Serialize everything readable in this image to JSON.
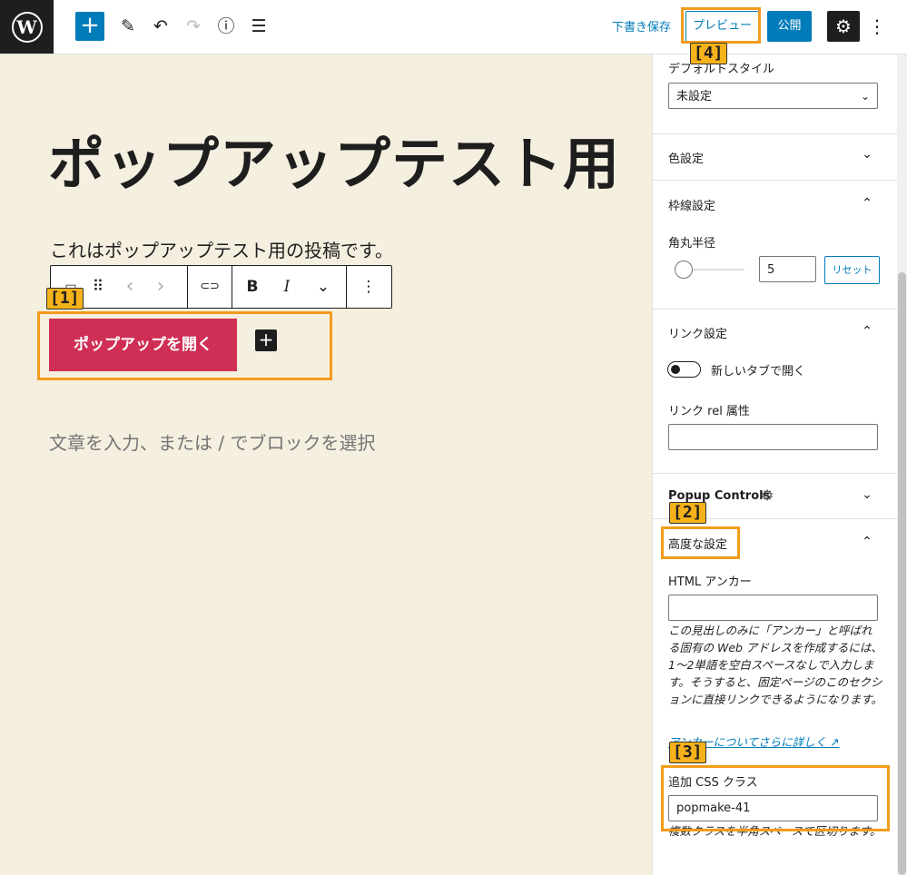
{
  "topbar": {
    "logo_letter": "W",
    "inserter_symbol": "+",
    "tools": [
      {
        "name": "edit-icon",
        "glyph": "✎"
      },
      {
        "name": "undo-icon",
        "glyph": "↶"
      },
      {
        "name": "redo-icon",
        "glyph": "↷"
      },
      {
        "name": "info-icon",
        "glyph": "ⓘ"
      },
      {
        "name": "list-view-icon",
        "glyph": "☰"
      }
    ],
    "save_draft": "下書き保存",
    "preview": "プレビュー",
    "publish": "公開",
    "settings_glyph": "⚙",
    "more_glyph": "⋮"
  },
  "editor": {
    "title": "ポップアップテスト用",
    "paragraph": "これはポップアップテスト用の投稿です。",
    "button_text": "ポップアップを開く",
    "add_block_glyph": "+",
    "placeholder": "文章を入力、または / でブロックを選択",
    "block_toolbar": {
      "drag": "⠿",
      "prev": "‹",
      "next": "›",
      "link": "⊂⊃",
      "bold": "B",
      "italic": "I",
      "more_rich": "⌄",
      "options": "⋮"
    }
  },
  "sidebar": {
    "default_style_label": "デフォルトスタイル",
    "default_style_value": "未設定",
    "color_panel": "色設定",
    "border_panel": "枠線設定",
    "radius_label": "角丸半径",
    "radius_value": "5",
    "reset": "リセット",
    "link_panel": "リンク設定",
    "new_tab_label": "新しいタブで開く",
    "rel_label": "リンク rel 属性",
    "popup_controls": "Popup Controls",
    "advanced_panel": "高度な設定",
    "html_anchor_label": "HTML アンカー",
    "anchor_help": "この見出しのみに「アンカー」と呼ばれる固有の Web アドレスを作成するには、1〜2単語を空白スペースなしで入力します。そうすると、固定ページのこのセクションに直接リンクできるようになります。",
    "anchor_link": "アンカーについてさらに詳しく",
    "css_class_label": "追加 CSS クラス",
    "css_class_value": "popmake-41",
    "css_help": "複数クラスを半角スペースで区切ります。",
    "chevron_down": "⌄",
    "chevron_up": "⌃"
  },
  "annotations": {
    "tag1": "[1]",
    "tag2": "[2]",
    "tag3": "[3]",
    "tag4": "[4]"
  },
  "colors": {
    "accent": "#007cba",
    "canvas": "#f5efe0",
    "button": "#cf2e55",
    "highlight": "#f29c1b"
  }
}
